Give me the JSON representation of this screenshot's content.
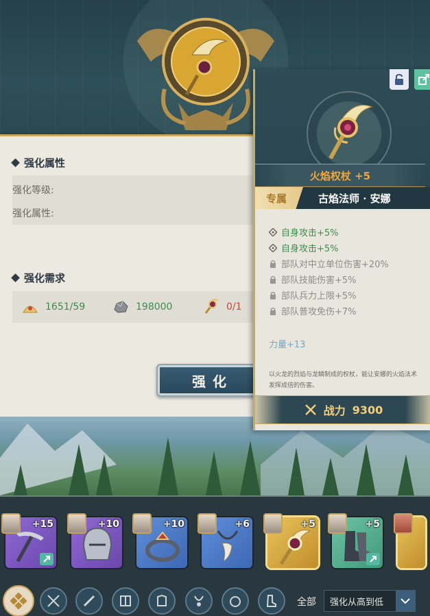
{
  "enhance_panel": {
    "attributes_title": "强化属性",
    "level_label": "强化等级:",
    "attribute_label": "强化属性:",
    "requirements_title": "强化需求",
    "requirements": [
      {
        "icon": "material-pile-icon",
        "value": "1651/59",
        "color": "#3e8a4c"
      },
      {
        "icon": "ore-stone-icon",
        "value": "198000",
        "color": "#3e8a4c"
      },
      {
        "icon": "scepter-copy-icon",
        "value": "0/1",
        "color": "#c24b3b"
      }
    ],
    "enhance_button": "强化"
  },
  "item_card": {
    "name": "火焰权杖 +5",
    "exclusive_tag": "专属",
    "exclusive_hero": "古焰法师 · 安娜",
    "stats": [
      {
        "text": "自身攻击+5%",
        "state": "active"
      },
      {
        "text": "自身攻击+5%",
        "state": "active"
      },
      {
        "text": "部队对中立单位伤害+20%",
        "state": "locked"
      },
      {
        "text": "部队技能伤害+5%",
        "state": "locked"
      },
      {
        "text": "部队兵力上限+5%",
        "state": "locked"
      },
      {
        "text": "部队普攻免伤+7%",
        "state": "locked"
      }
    ],
    "strength": "力量+13",
    "description_line1": "以火龙的烈焰与龙鳞制成的权杖，能让安娜的火焰法术",
    "description_line2": "发挥成倍的伤害。",
    "power_label": "战力",
    "power_value": "9300"
  },
  "inventory": {
    "slots": [
      {
        "name": "pickaxe",
        "level": "+15",
        "rarity": "purple",
        "badge": true
      },
      {
        "name": "helmet",
        "level": "+10",
        "rarity": "purple",
        "badge": false
      },
      {
        "name": "ring",
        "level": "+10",
        "rarity": "blue",
        "badge": false
      },
      {
        "name": "tooth-necklace",
        "level": "+6",
        "rarity": "blue",
        "badge": false
      },
      {
        "name": "fire-scepter",
        "level": "+5",
        "rarity": "gold",
        "badge": false
      },
      {
        "name": "boots",
        "level": "+5",
        "rarity": "green",
        "badge": true
      }
    ],
    "all_label": "全部",
    "sort_label": "强化从高到低"
  },
  "colors": {
    "gold_accent": "#c9a95b",
    "name_orange": "#f0a63c",
    "stat_green": "#3f8c4d",
    "strength_blue": "#6fa7cc"
  }
}
